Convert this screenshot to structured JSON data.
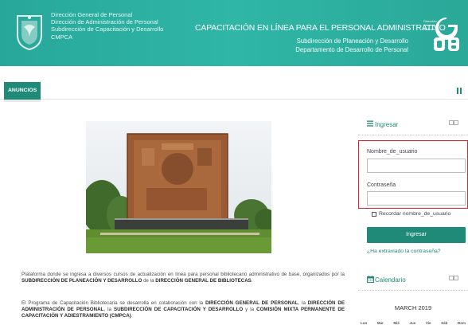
{
  "header": {
    "left_lines": [
      "Dirección General de Personal",
      "Dirección de Administración de Personal",
      "Subdirección de Capacitación y Desarrollo",
      "CMPCA"
    ],
    "title": "CAPACITACIÓN EN LÍNEA PARA EL PERSONAL ADMINISTRATIVO",
    "subtitle1": "Subdirección de Planeación y Desarrollo",
    "subtitle2": "Departamento de Desarrollo de Personal",
    "dgb_lines": [
      "Dirección",
      "General de",
      "Bibliotecas"
    ],
    "color": "#2aa898"
  },
  "nav": {
    "tab_anuncios": "ANUNCIOS"
  },
  "main": {
    "p1_a": "Plataforma donde se ingresa a diversos cursos de actualización en línea para personal bibliotecario administrativo de base, organizados por la ",
    "p1_b": "SUBDIRECCIÓN DE PLANEACIÓN Y DESARROLLO",
    "p1_c": " de la ",
    "p1_d": "DIRECCIÓN GENERAL DE BIBLIOTECAS",
    "p1_e": ".",
    "p2_a": "El Programa de Capacitación Bibliotecaria se desarrolla en colaboración con la ",
    "p2_b": "DIRECCIÓN GENERAL DE PERSONAL",
    "p2_c": ", la ",
    "p2_d": "DIRECCIÓN DE ADMINISTRACIÓN DE PERSONAL",
    "p2_e": ", la ",
    "p2_f": "SUBDIRECCIÓN DE CAPACITACIÓN Y DESARROLLO",
    "p2_g": " y la ",
    "p2_h": "COMISIÓN MIXTA PERMANENTE DE CAPACITACIÓN Y ADIESTRAMIENTO (CMPCA)",
    "p2_i": "."
  },
  "login": {
    "title": "Ingresar",
    "username_label": "Nombre_de_usuario",
    "password_label": "Contraseña",
    "remember_label": "Recordar nombre_de_usuario",
    "button": "Ingresar",
    "lost_password": "¿Ha extraviado la contraseña?",
    "accent": "#1f8a77",
    "highlight": "#e0242c"
  },
  "calendar": {
    "title": "Calendario",
    "month": "MARCH 2019",
    "days": [
      "Lun",
      "Mar",
      "Mié",
      "Jue",
      "Vie",
      "Sáb",
      "Dom"
    ]
  },
  "icons": [
    "unam-logo-icon",
    "dgb-logo-icon",
    "nav-toggle-icon",
    "menu-lines-icon",
    "calendar-icon",
    "block-controls-icon"
  ]
}
